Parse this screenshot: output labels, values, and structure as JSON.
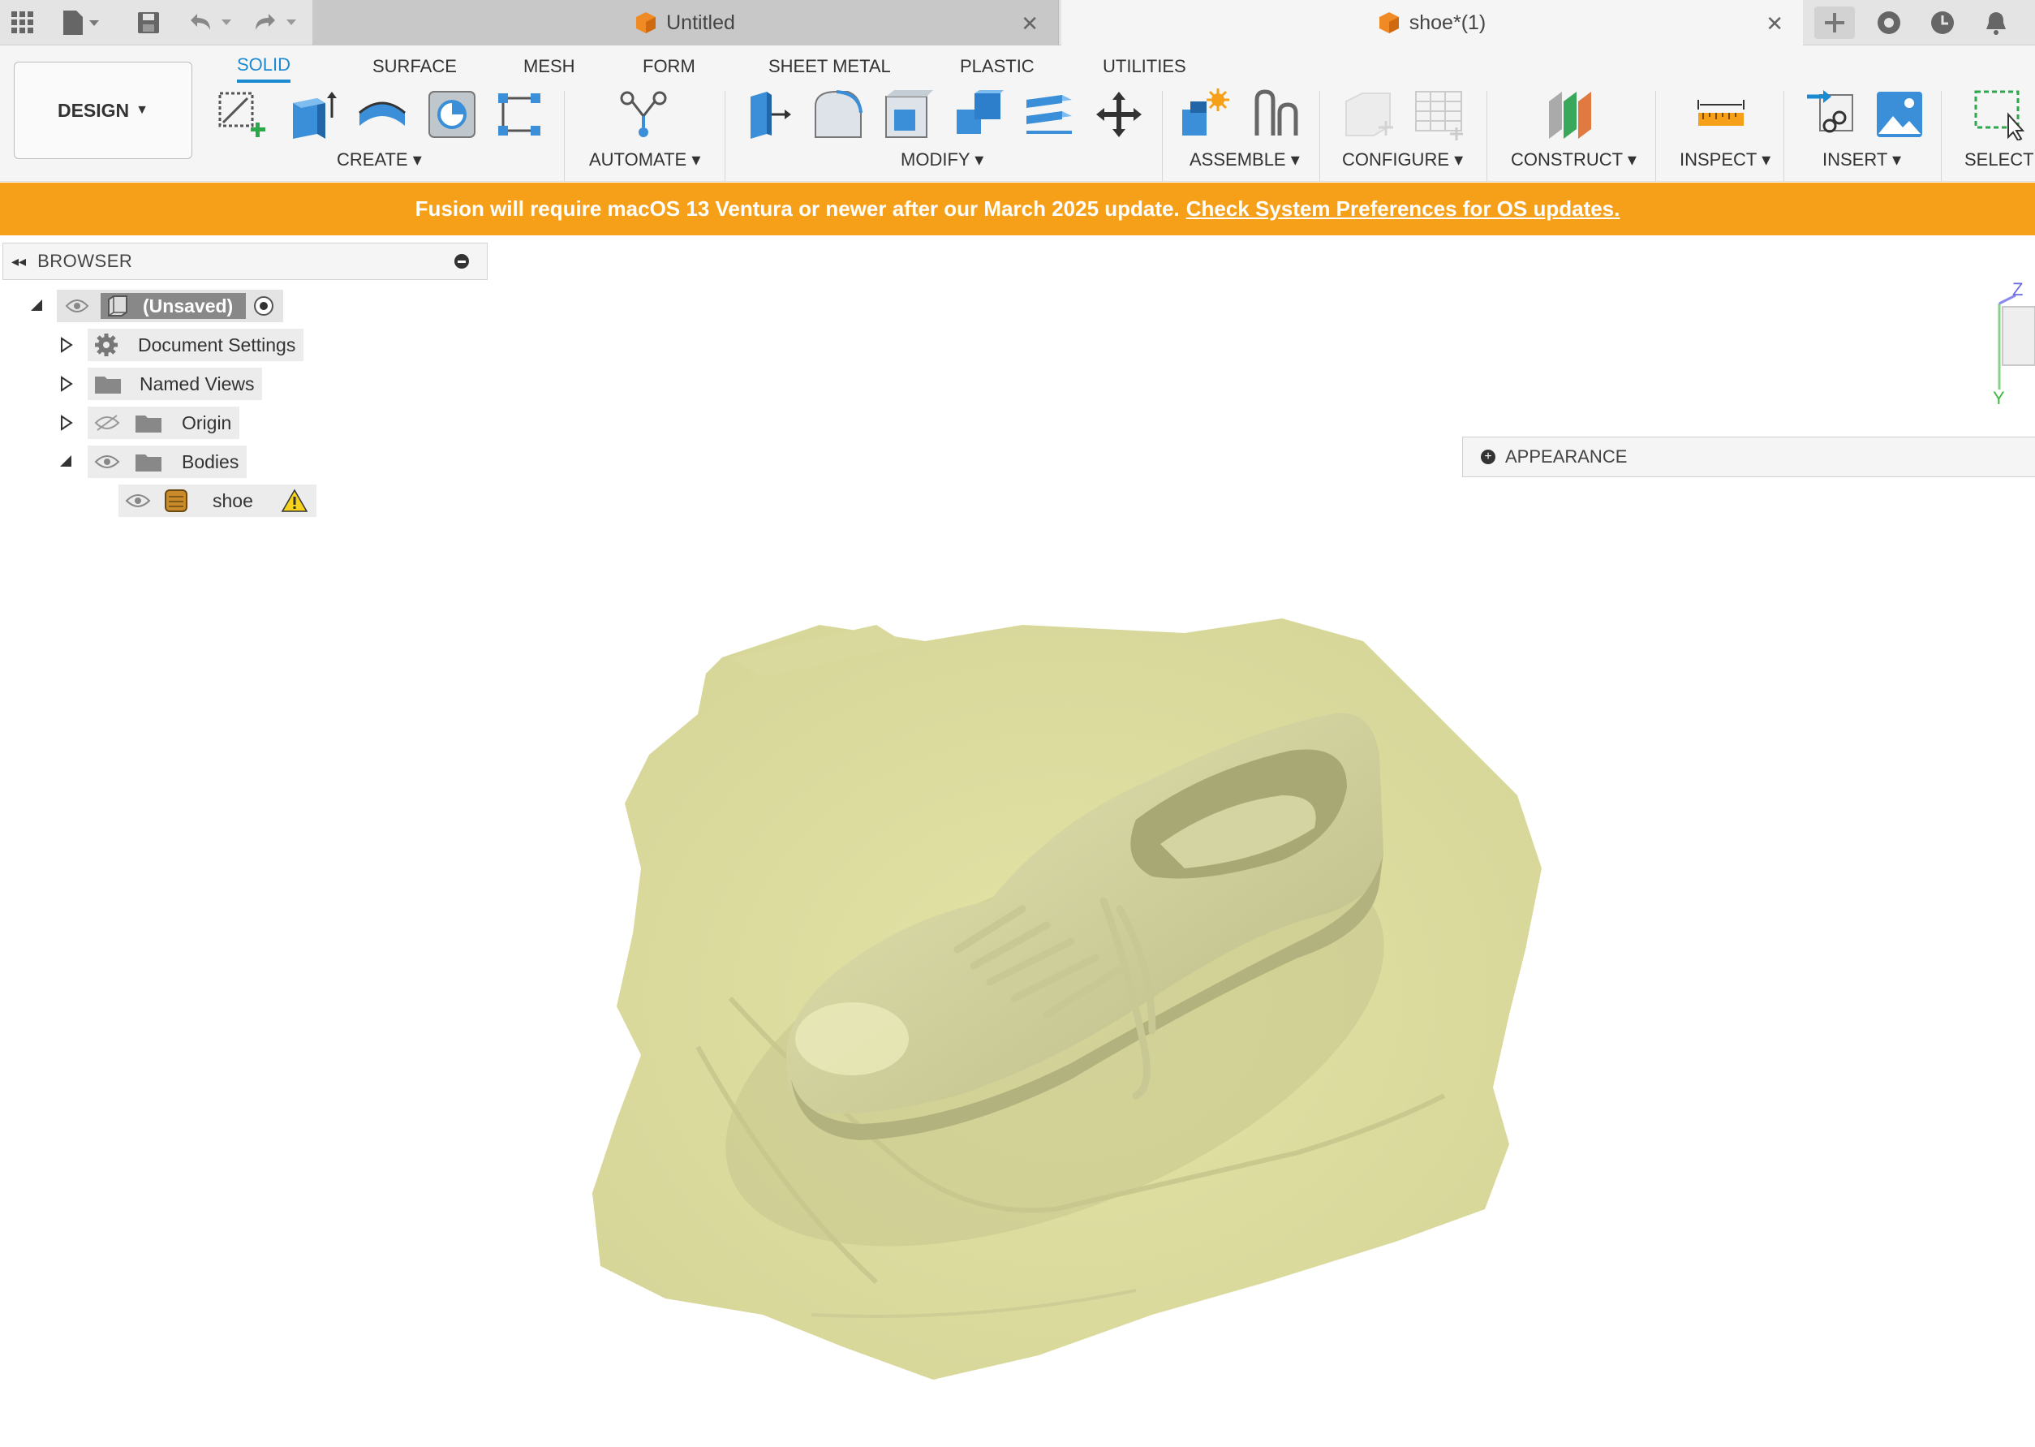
{
  "tabs": [
    {
      "title": "Untitled",
      "close": "✕"
    },
    {
      "title": "shoe*(1)",
      "close": "✕"
    }
  ],
  "ribbon": {
    "design_label": "DESIGN",
    "workspace_tabs": [
      "SOLID",
      "SURFACE",
      "MESH",
      "FORM",
      "SHEET METAL",
      "PLASTIC",
      "UTILITIES"
    ],
    "active_tab": "SOLID",
    "groups": [
      "CREATE",
      "AUTOMATE",
      "MODIFY",
      "ASSEMBLE",
      "CONFIGURE",
      "CONSTRUCT",
      "INSPECT",
      "INSERT",
      "SELECT"
    ]
  },
  "banner": {
    "message": "Fusion will require macOS 13 Ventura or newer after our March 2025 update.",
    "link": "Check System Preferences for OS updates."
  },
  "browser": {
    "title": "BROWSER",
    "root": "(Unsaved)",
    "items": [
      {
        "label": "Document Settings",
        "icon": "gear-icon"
      },
      {
        "label": "Named Views",
        "icon": "folder-icon"
      },
      {
        "label": "Origin",
        "icon": "folder-icon",
        "visibility": "hidden"
      },
      {
        "label": "Bodies",
        "icon": "folder-icon",
        "visibility": "visible"
      },
      {
        "label": "shoe",
        "icon": "body-icon",
        "warning": true
      }
    ]
  },
  "viewcube": {
    "z": "Z",
    "y": "Y"
  },
  "appearance_panel": {
    "title": "APPEARANCE"
  },
  "colors": {
    "accent": "#1b8ad0",
    "banner": "#f6a019",
    "mesh": "#d8d89a"
  }
}
